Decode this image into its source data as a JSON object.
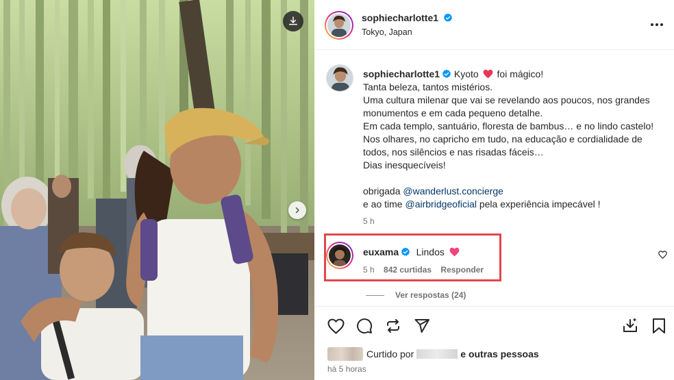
{
  "post": {
    "photo": {
      "download_icon": "download-icon",
      "next_icon": "chevron-right-icon"
    },
    "header": {
      "username": "sophiecharlotte1",
      "location": "Tokyo, Japan",
      "more_icon": "more-horizontal-icon"
    },
    "caption": {
      "username": "sophiecharlotte1",
      "first_line_a": "Kyoto",
      "first_line_b": "foi mágico!",
      "lines": [
        "Tanta beleza, tantos mistérios.",
        "Uma cultura milenar que vai se revelando aos poucos, nos grandes",
        "monumentos e em cada pequeno detalhe.",
        "Em cada templo, santuário, floresta de bambus… e no lindo castelo!",
        "Nos olhares, no capricho em tudo, na educação e cordialidade de",
        "todos, nos silêncios e nas risadas fáceis…",
        "Dias inesquecíveis!"
      ],
      "thanks_a": "obrigada",
      "mention_1": "@wanderlust.concierge",
      "thanks_b": "e ao time",
      "mention_2": "@airbridgeoficial",
      "thanks_c": "pela experiência impecável !",
      "time": "5 h"
    },
    "comment": {
      "username": "euxama",
      "text": "Lindos",
      "time": "5 h",
      "likes": "842 curtidas",
      "reply": "Responder",
      "highlight_color": "#e3474a"
    },
    "view_replies": "Ver respostas (24)",
    "liked_by": {
      "prefix": "Curtido por",
      "suffix": "e outras pessoas"
    },
    "posted": "há 5 horas",
    "colors": {
      "verified": "#0095f6",
      "heart": "#ff3040",
      "mention": "#00376b"
    }
  }
}
